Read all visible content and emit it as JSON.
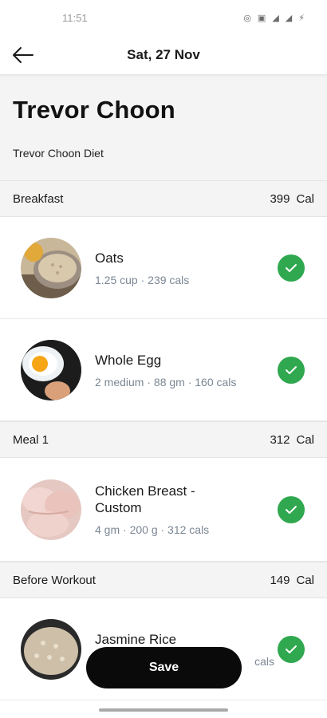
{
  "status_bar": {
    "time": "11:51"
  },
  "appbar": {
    "title": "Sat, 27 Nov"
  },
  "header": {
    "client_name": "Trevor Choon",
    "diet_name": "Trevor Choon Diet"
  },
  "sections": [
    {
      "title": "Breakfast",
      "calories": "399",
      "unit": "Cal",
      "items": [
        {
          "name": "Oats",
          "meta": "1.25 cup · 239 cals",
          "image": "oats-image"
        },
        {
          "name": "Whole Egg",
          "meta": "2 medium · 88 gm · 160 cals",
          "image": "egg-image"
        }
      ]
    },
    {
      "title": "Meal 1",
      "calories": "312",
      "unit": "Cal",
      "items": [
        {
          "name": "Chicken Breast - Custom",
          "meta": "4 gm · 200 g · 312 cals",
          "image": "chicken-image"
        }
      ]
    },
    {
      "title": "Before Workout",
      "calories": "149",
      "unit": "Cal",
      "items": [
        {
          "name": "Jasmine Rice",
          "meta": "cals",
          "image": "rice-image"
        }
      ]
    }
  ],
  "save_label": "Save",
  "colors": {
    "check_green": "#2fa84f",
    "save_bg": "#0a0a0a",
    "section_bg": "#f4f4f4"
  }
}
